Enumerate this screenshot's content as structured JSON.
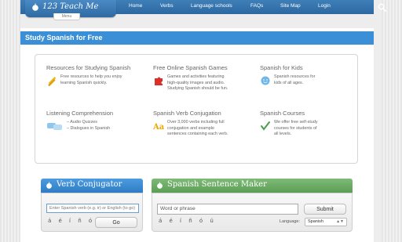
{
  "header": {
    "logo_text": "123 Teach Me",
    "menu_label": "Menu",
    "nav": [
      "Home",
      "Verbs",
      "Language schools",
      "FAQs",
      "Site Map",
      "Login"
    ]
  },
  "page_title": "Study Spanish for Free",
  "resources": [
    {
      "title": "Resources for Studying Spanish",
      "desc": [
        "Free resources to help you enjoy",
        "learning Spanish quickly."
      ],
      "icon": "pencils-icon"
    },
    {
      "title": "Free Online Spanish Games",
      "desc": [
        "Games and activities featuring",
        "high-quality images and audio.",
        "Studying Spanish should be fun."
      ],
      "icon": "puzzle-icon"
    },
    {
      "title": "Spanish for Kids",
      "desc": [
        "Spanish resources for",
        "kids of all ages."
      ],
      "icon": "smiley-icon"
    },
    {
      "title": "Listening Comprehension",
      "desc": [
        "– Audio Quizzes",
        "– Dialogues in Spanish"
      ],
      "icon": "speech-bubbles-icon"
    },
    {
      "title": "Spanish Verb Conjugation",
      "desc": [
        "Over 3,000 verbs including full",
        "conjugation and example",
        "sentences containing each verb."
      ],
      "icon": "aa-icon"
    },
    {
      "title": "Spanish Courses",
      "desc": [
        "We offer free self-study",
        "courses for students of",
        "all levels."
      ],
      "icon": "checkmark-icon"
    }
  ],
  "conjugator": {
    "title": "Verb Conjugator",
    "placeholder": "Enter Spanish verb (e.g. ir) or English (to go)",
    "accents": "á é í ñ ó ú",
    "button": "Go"
  },
  "sentence_maker": {
    "title": "Spanish Sentence Maker",
    "placeholder": "Word or phrase",
    "button": "Submit",
    "accents": "á é í ñ ó ú",
    "language_label": "Language:",
    "language_value": "Spanish"
  },
  "colors": {
    "nav_blue": "#2d68a1",
    "title_blue": "#3a8fd6",
    "conjugator_blue": "#3d8fd8",
    "sentence_green": "#6aab63"
  }
}
